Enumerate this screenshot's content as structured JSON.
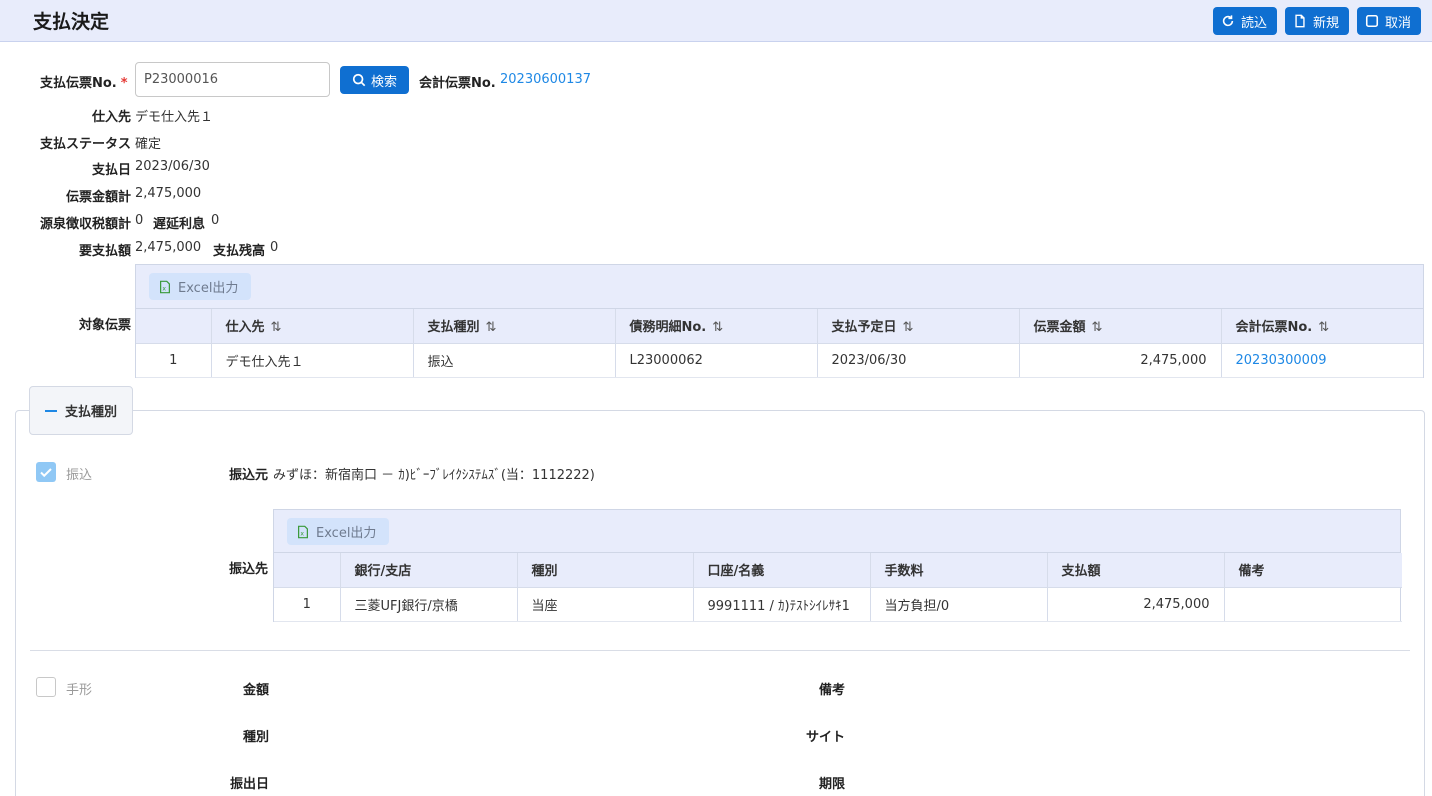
{
  "header": {
    "title": "支払決定",
    "buttons": {
      "reload": "読込",
      "new": "新規",
      "cancel": "取消"
    }
  },
  "form": {
    "payment_no_label": "支払伝票No.",
    "payment_no_required": "*",
    "payment_no_value": "P23000016",
    "search_button": "検索",
    "accounting_no_label": "会計伝票No.",
    "accounting_no_value": "20230600137",
    "supplier_label": "仕入先",
    "supplier_value": "デモ仕入先１",
    "status_label": "支払ステータス",
    "status_value": "確定",
    "payment_date_label": "支払日",
    "payment_date_value": "2023/06/30",
    "total_label": "伝票金額計",
    "total_value": "2,475,000",
    "withholding_label": "源泉徴収税額計",
    "withholding_value": "0",
    "late_interest_label": "遅延利息",
    "late_interest_value": "0",
    "required_label": "要支払額",
    "required_value": "2,475,000",
    "balance_label": "支払残高",
    "balance_value": "0",
    "target_label": "対象伝票"
  },
  "target_table": {
    "excel_button": "Excel出力",
    "columns": [
      "",
      "仕入先",
      "支払種別",
      "債務明細No.",
      "支払予定日",
      "伝票金額",
      "会計伝票No."
    ],
    "sort_glyph": "⇅",
    "rows": [
      [
        "1",
        "デモ仕入先１",
        "振込",
        "L23000062",
        "2023/06/30",
        "2,475,000",
        "20230300009"
      ]
    ]
  },
  "payment_section": {
    "tab_label": "支払種別",
    "transfer_checkbox_label": "振込",
    "transfer_from_label": "振込元",
    "transfer_from_value": "みずほ：新宿南口 － ｶ)ﾋﾞｰﾌﾞﾚｲｸｼｽﾃﾑｽﾞ(当：1112222)",
    "transfer_to_label": "振込先",
    "transfer_table": {
      "excel_button": "Excel出力",
      "columns": [
        "",
        "銀行/支店",
        "種別",
        "口座/名義",
        "手数料",
        "支払額",
        "備考"
      ],
      "rows": [
        [
          "1",
          "三菱UFJ銀行/京橋",
          "当座",
          "9991111 / ｶ)ﾃｽﾄｼｲﾚｻｷ1",
          "当方負担/0",
          "2,475,000",
          ""
        ]
      ]
    },
    "bill_checkbox_label": "手形",
    "bill_fields": {
      "amount": "金額",
      "type": "種別",
      "issue_date": "振出日",
      "remarks": "備考",
      "site": "サイト",
      "due": "期限"
    }
  },
  "colors": {
    "accent": "#0f6fd1",
    "header_bg": "#e8ecfb",
    "link": "#1e88e5"
  }
}
